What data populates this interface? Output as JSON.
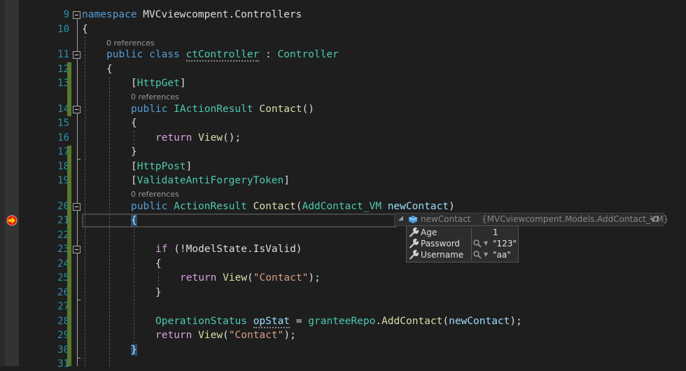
{
  "editor": {
    "line_numbers": [
      "9",
      "10",
      "11",
      "12",
      "13",
      "14",
      "15",
      "16",
      "17",
      "18",
      "19",
      "20",
      "21",
      "22",
      "23",
      "24",
      "25",
      "26",
      "27",
      "28",
      "29",
      "30",
      "31"
    ],
    "codelens": {
      "class_refs": "0 references",
      "get_refs": "0 references",
      "post_refs": "0 references"
    },
    "lines": {
      "l9_kw": "namespace",
      "l9_name": " MVCviewcompent.Controllers",
      "l10": "{",
      "l11_public": "public",
      "l11_class": "class",
      "l11_name": "ctController",
      "l11_colon": " : ",
      "l11_base": "Controller",
      "l12": "{",
      "l13_open": "[",
      "l13_attr": "HttpGet",
      "l13_close": "]",
      "l14_public": "public",
      "l14_type": "IActionResult",
      "l14_method": "Contact",
      "l14_parens": "()",
      "l15": "{",
      "l16_return": "return",
      "l16_view": "View",
      "l16_rest": "();",
      "l17": "}",
      "l18_open": "[",
      "l18_attr": "HttpPost",
      "l18_close": "]",
      "l19_open": "[",
      "l19_attr": "ValidateAntiForgeryToken",
      "l19_close": "]",
      "l20_public": "public",
      "l20_type": "ActionResult",
      "l20_method": "Contact",
      "l20_open": "(",
      "l20_ptype": "AddContact_VM",
      "l20_pname": "newContact",
      "l20_close": ")",
      "l21": "{",
      "l23_if": "if",
      "l23_rest": " (!ModelState.IsValid)",
      "l24": "{",
      "l25_return": "return",
      "l25_view": "View",
      "l25_open": "(",
      "l25_str": "\"Contact\"",
      "l25_close": ");",
      "l26": "}",
      "l28_type": "OperationStatus",
      "l28_var": "opStat",
      "l28_eq": " = ",
      "l28_repo": "granteeRepo",
      "l28_dot": ".",
      "l28_method": "AddContact",
      "l28_open": "(",
      "l28_arg": "newContact",
      "l28_close": ");",
      "l29_return": "return",
      "l29_view": "View",
      "l29_open": "(",
      "l29_str": "\"Contact\"",
      "l29_close": ");",
      "l30": "}"
    }
  },
  "datatip": {
    "variable": "newContact",
    "value": "{MVCviewcompent.Models.AddContact_VM}",
    "properties": [
      {
        "name": "Age",
        "value": "1",
        "has_visualizer": false
      },
      {
        "name": "Password",
        "value": "\"123\"",
        "has_visualizer": true
      },
      {
        "name": "Username",
        "value": "\"aa\"",
        "has_visualizer": true
      }
    ]
  },
  "colors": {
    "line_number": "#2b91af",
    "keyword": "#569cd6",
    "control_keyword": "#d8a0df",
    "type": "#4ec9b0",
    "method": "#dcdcaa",
    "string": "#d69d85",
    "parameter": "#9cdcfe",
    "change_bar": "#577a2e"
  }
}
